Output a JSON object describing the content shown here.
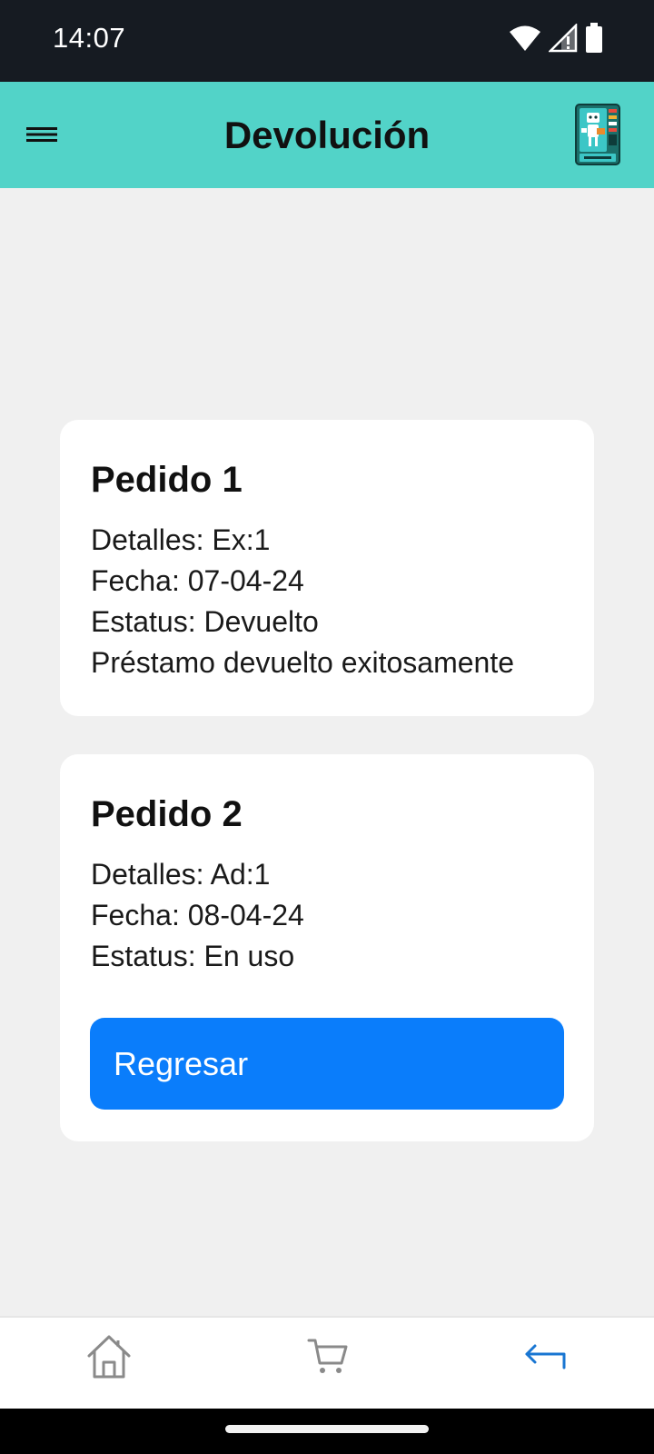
{
  "status_bar": {
    "time": "14:07"
  },
  "app_bar": {
    "title": "Devolución",
    "menu_icon": "menu-icon",
    "logo_icon": "vending-machine-logo"
  },
  "orders": [
    {
      "title": "Pedido 1",
      "details": "Detalles: Ex:1",
      "date": "Fecha: 07-04-24",
      "status": "Estatus: Devuelto",
      "message": "Préstamo devuelto exitosamente"
    },
    {
      "title": "Pedido 2",
      "details": "Detalles: Ad:1",
      "date": "Fecha: 08-04-24",
      "status": "Estatus: En uso",
      "button_label": "Regresar"
    }
  ],
  "bottom_nav": {
    "items": [
      {
        "icon": "home-icon",
        "active": false
      },
      {
        "icon": "cart-icon",
        "active": false
      },
      {
        "icon": "return-icon",
        "active": true
      }
    ]
  },
  "colors": {
    "accent": "#52d3c8",
    "primary_button": "#0a7dfb",
    "active_nav": "#1976d2",
    "inactive_nav": "#8a8a8a",
    "background": "#f0f0f0"
  }
}
